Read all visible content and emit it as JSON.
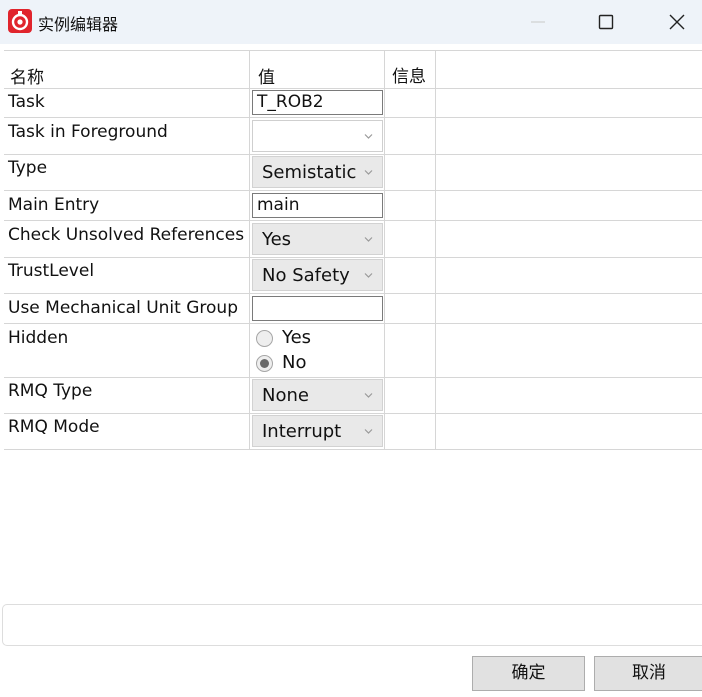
{
  "window": {
    "title": "实例编辑器",
    "icons": {
      "app": "robot-app-icon",
      "minimize": "minimize-icon",
      "maximize": "maximize-icon",
      "close": "close-icon"
    }
  },
  "table": {
    "headers": {
      "name": "名称",
      "value": "值",
      "info": "信息"
    },
    "rows": {
      "task": {
        "label": "Task",
        "value": "T_ROB2"
      },
      "task_in_foreground": {
        "label": "Task in Foreground",
        "value": ""
      },
      "type": {
        "label": "Type",
        "value": "Semistatic"
      },
      "main_entry": {
        "label": "Main Entry",
        "value": "main"
      },
      "check_unsolved": {
        "label": "Check Unsolved References",
        "value": "Yes"
      },
      "trust_level": {
        "label": "TrustLevel",
        "value": "No Safety"
      },
      "use_mech_unit_group": {
        "label": "Use Mechanical Unit Group",
        "value": ""
      },
      "hidden": {
        "label": "Hidden",
        "options": [
          "Yes",
          "No"
        ],
        "selected": "No"
      },
      "rmq_type": {
        "label": "RMQ Type",
        "value": "None"
      },
      "rmq_mode": {
        "label": "RMQ Mode",
        "value": "Interrupt"
      }
    }
  },
  "buttons": {
    "ok": "确定",
    "cancel": "取消"
  },
  "colors": {
    "titlebar_bg": "#eef3f9",
    "app_icon_red": "#e0242c",
    "combo_bg": "#e9e9e9",
    "button_bg": "#e1e1e1"
  }
}
